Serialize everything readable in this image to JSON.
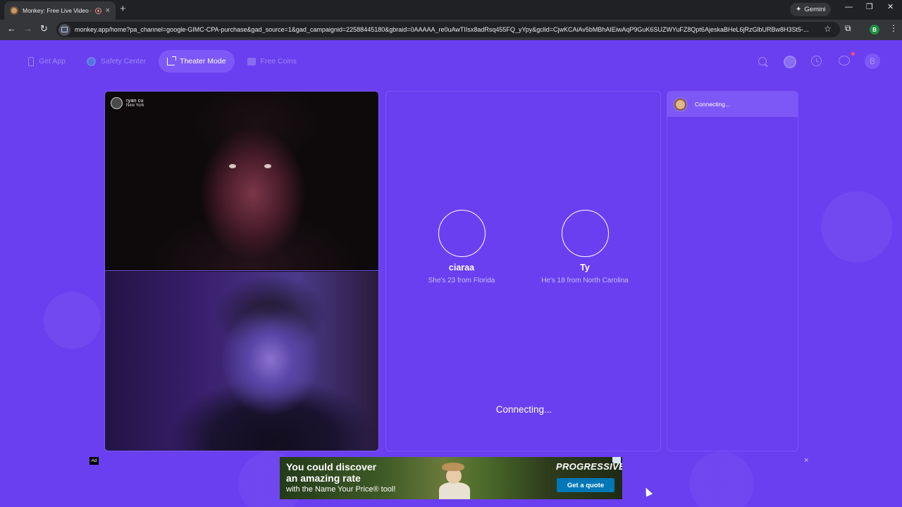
{
  "browser": {
    "tab_title": "Monkey: Free Live Video Ch",
    "tab_close": "×",
    "new_tab": "+",
    "gemini_label": "Gemini",
    "url": "monkey.app/home?pa_channel=google-GIMC-CPA-purchase&gad_source=1&gad_campaignid=22588445180&gbraid=0AAAAA_re0uAwTIIsx8adRsq455FQ_yYpy&gclid=CjwKCAiAv5bMBhAIEiwAqP9GuK6SUZWYuFZ8Qpt6AjeskaBHeL6jRzGlbURBw8H3St5-...",
    "profile_initial": "B",
    "icons": [
      "back-icon",
      "forward-icon",
      "reload-icon",
      "site-info-icon",
      "bookmark-star-icon",
      "extensions-icon",
      "menu-icon"
    ]
  },
  "nav": {
    "items": [
      {
        "label": "Get App",
        "icon": "phone-icon",
        "active": false
      },
      {
        "label": "Safety Center",
        "icon": "shield-icon",
        "active": false
      },
      {
        "label": "Theater Mode",
        "icon": "expand-icon",
        "active": true
      },
      {
        "label": "Free Coins",
        "icon": "coin-icon",
        "active": false
      }
    ],
    "profile_initial": "B"
  },
  "video": {
    "peer_name": "ryan cu",
    "peer_location": "New York"
  },
  "match": {
    "candidates": [
      {
        "name": "ciaraa",
        "description": "She's 23 from Florida"
      },
      {
        "name": "Ty",
        "description": "He's 18 from North Carolina"
      }
    ],
    "status": "Connecting..."
  },
  "chat": {
    "status": "Connecting..."
  },
  "ad": {
    "label": "Ad",
    "headline_1": "You could discover",
    "headline_2": "an amazing rate",
    "subline": "with the Name Your Price® tool!",
    "brand": "PROGRESSIVE",
    "cta": "Get a quote",
    "close": "×"
  },
  "colors": {
    "page_bg": "#6a3ff0",
    "active_pill": "#7e58f7",
    "ad_cta": "#0077b6"
  }
}
